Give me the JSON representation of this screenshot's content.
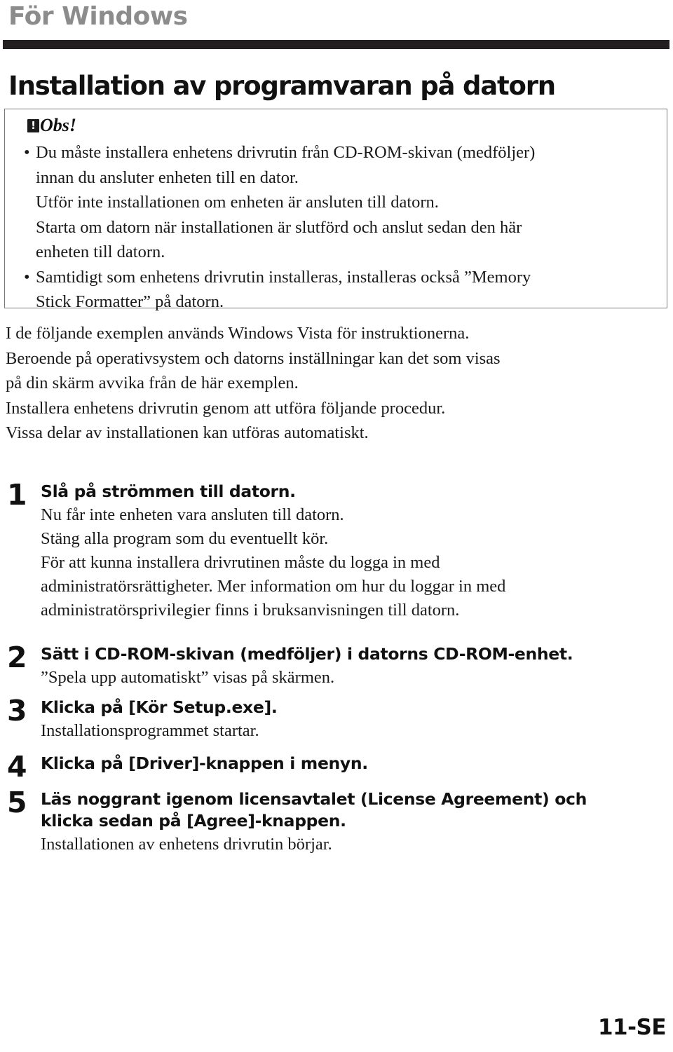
{
  "header": {
    "section_label": "För Windows",
    "chapter_title": "Installation av programvaran på datorn"
  },
  "notice": {
    "icon_name": "warning-exclamation-icon",
    "icon_glyph": "!",
    "heading": "Obs!",
    "bullets": [
      {
        "marker": "•",
        "lines": [
          "Du måste installera enhetens drivrutin från CD-ROM-skivan (medföljer)",
          "innan du ansluter enheten till en dator.",
          "Utför inte installationen om enheten är ansluten till datorn.",
          "Starta om datorn när installationen är slutförd och anslut sedan den här",
          "enheten till datorn."
        ]
      },
      {
        "marker": "•",
        "lines": [
          "Samtidigt som enhetens drivrutin installeras, installeras också ”Memory",
          "Stick Formatter” på datorn."
        ]
      }
    ]
  },
  "intro": {
    "lines": [
      "I de följande exemplen används Windows Vista för instruktionerna.",
      "Beroende på operativsystem och datorns inställningar kan det som visas",
      "på din skärm avvika från de här exemplen.",
      "Installera enhetens drivrutin genom att utföra följande procedur.",
      "Vissa delar av installationen kan utföras automatiskt."
    ]
  },
  "steps": [
    {
      "number": "1",
      "title_lines": [
        "Slå på strömmen till datorn."
      ],
      "desc_lines": [
        "Nu får inte enheten vara ansluten till datorn.",
        "Stäng alla program som du eventuellt kör.",
        "För att kunna installera drivrutinen måste du logga in med",
        "administratörsrättigheter. Mer information om hur du loggar in med",
        "administratörsprivilegier finns i bruksanvisningen till datorn."
      ]
    },
    {
      "number": "2",
      "title_lines": [
        "Sätt i CD-ROM-skivan (medföljer) i datorns CD-ROM-enhet."
      ],
      "desc_lines": [
        "”Spela upp automatiskt” visas på skärmen."
      ]
    },
    {
      "number": "3",
      "title_lines": [
        "Klicka på [Kör Setup.exe]."
      ],
      "desc_lines": [
        "Installationsprogrammet startar."
      ]
    },
    {
      "number": "4",
      "title_lines": [
        "Klicka på [Driver]-knappen i menyn."
      ],
      "desc_lines": []
    },
    {
      "number": "5",
      "title_lines": [
        "Läs noggrant igenom licensavtalet (License Agreement) och",
        "klicka sedan på [Agree]-knappen."
      ],
      "desc_lines": [
        "Installationen av enhetens drivrutin börjar."
      ]
    }
  ],
  "footer": {
    "folio": "11-SE"
  },
  "colors": {
    "section_label": "#8c8c8c",
    "rule_bar": "#231f20",
    "text": "#1a1a1a",
    "box_border": "#7a7a7a"
  }
}
